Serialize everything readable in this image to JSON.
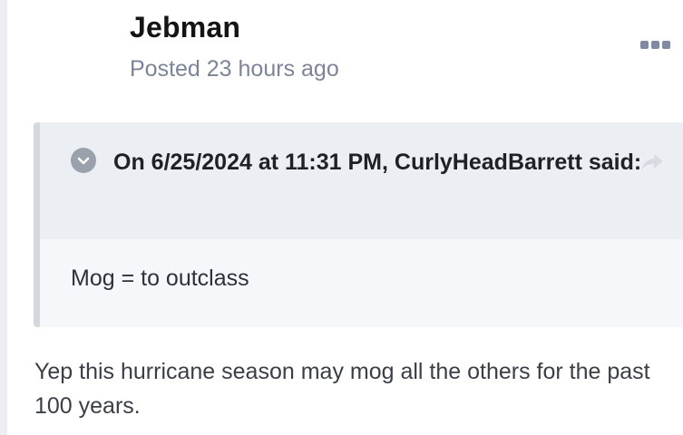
{
  "post": {
    "author": "Jebman",
    "meta": "Posted 23 hours ago",
    "quote": {
      "citation_prefix": "On 6/25/2024 at 11:31 PM, ",
      "citation_author": "CurlyHeadBarrett",
      "citation_suffix": " said:",
      "body": "Mog = to outclass"
    },
    "text": "Yep this hurricane season may mog all the others for the past 100 years."
  },
  "icons": {
    "more": "more-options-icon",
    "toggle": "chevron-down-icon",
    "share": "share-arrow-icon"
  },
  "colors": {
    "author": "#141414",
    "meta": "#7c8499",
    "quote_background": "#f5f7fa",
    "quote_header": "#ebeef2",
    "quote_border": "#d4d8de"
  }
}
